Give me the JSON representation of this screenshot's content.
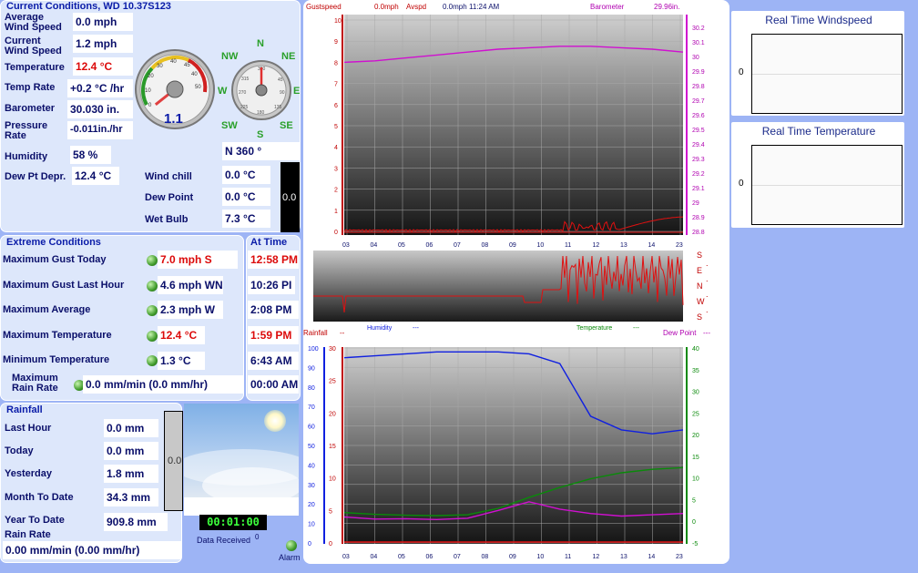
{
  "current": {
    "title": "Current Conditions, WD 10.37S123",
    "avg_wind_label": "Average\nWind Speed",
    "avg_wind": "0.0 mph",
    "cur_wind_label": "Current\nWind Speed",
    "cur_wind": "1.2 mph",
    "temp_label": "Temperature",
    "temp": "12.4 °C",
    "temp_rate_label": "Temp Rate",
    "temp_rate": "+0.2 °C /hr",
    "baro_label": "Barometer",
    "baro": "30.030 in.",
    "press_rate_label": "Pressure\nRate",
    "press_rate": "-0.011in./hr",
    "humidity_label": "Humidity",
    "humidity": "58 %",
    "dewdep_label": "Dew Pt Depr.",
    "dewdep": "12.4 °C",
    "windchill_label": "Wind chill",
    "windchill": "0.0 °C",
    "dewpoint_label": "Dew Point",
    "dewpoint": "0.0 °C",
    "wetbulb_label": "Wet Bulb",
    "wetbulb": "7.3 °C",
    "gauge_value": "1.1",
    "gauge_level": 1.1,
    "wind_dir": "N  360 °",
    "bar_reading": "0.0",
    "compass": {
      "n": "N",
      "ne": "NE",
      "e": "E",
      "se": "SE",
      "s": "S",
      "sw": "SW",
      "w": "W",
      "nw": "NW"
    }
  },
  "extreme": {
    "title": "Extreme Conditions",
    "max_gust_today_label": "Maximum Gust Today",
    "max_gust_today": "7.0 mph S",
    "max_gust_hour_label": "Maximum Gust Last Hour",
    "max_gust_hour": "4.6 mph WN'",
    "max_avg_label": "Maximum Average",
    "max_avg": "2.3 mph W",
    "max_temp_label": "Maximum Temperature",
    "max_temp": "12.4 °C",
    "min_temp_label": "Minimum Temperature",
    "min_temp": "1.3 °C",
    "max_rain_label": "Maximum\nRain Rate",
    "max_rain": "0.0 mm/min (0.0 mm/hr)"
  },
  "attime": {
    "title": "At Time",
    "t1": "12:58 PM",
    "t2": "10:26 PI",
    "t3": "2:08 PM",
    "t4": "1:59 PM",
    "t5": "6:43 AM",
    "t6": "00:00 AM"
  },
  "rainfall": {
    "title": "Rainfall",
    "last_hour_label": "Last Hour",
    "last_hour": "0.0 mm",
    "today_label": "Today",
    "today": "0.0 mm",
    "yesterday_label": "Yesterday",
    "yesterday": "1.8 mm",
    "month_label": "Month To Date",
    "month": "34.3 mm",
    "year_label": "Year To Date",
    "year": "909.8 mm",
    "rate_label": "Rain Rate",
    "rate": "0.00 mm/min (0.00 mm/hr)",
    "gauge_reading": "0.0"
  },
  "status": {
    "timer": "00:01:00",
    "data_received": "Data Received",
    "data_count": "0",
    "alarm": "Alarm"
  },
  "right": {
    "windspeed_title": "Real Time Windspeed",
    "windspeed_value": "0",
    "temp_title": "Real Time Temperature",
    "temp_value": "0"
  },
  "chart_data": [
    {
      "type": "line",
      "header": {
        "gust": "Gustspeed",
        "gust_val": "0.0mph",
        "avg": "Avspd",
        "avg_val": "0.0mph",
        "time": "11:24 AM",
        "baro": "Barometer",
        "baro_val": "29.96in."
      },
      "x_ticks": [
        "03",
        "04",
        "05",
        "06",
        "07",
        "08",
        "09",
        "10",
        "11",
        "12",
        "13",
        "14",
        "23"
      ],
      "y_left": [
        0,
        1,
        2,
        3,
        4,
        5,
        6,
        7,
        8,
        9,
        10
      ],
      "y_right": [
        "30.2",
        "30.1",
        "30",
        "29.9",
        "29.8",
        "29.7",
        "29.6",
        "29.5",
        "29.4",
        "29.3",
        "29.2",
        "29.1",
        "29",
        "28.9",
        "28.8"
      ],
      "series": [
        {
          "name": "Barometer",
          "color": "#d010d0",
          "values": [
            29.96,
            29.97,
            29.99,
            30.01,
            30.03,
            30.05,
            30.06,
            30.07,
            30.07,
            30.06,
            30.05,
            30.03
          ]
        }
      ]
    },
    {
      "type": "line",
      "right_labels": [
        "S",
        "E",
        "N",
        "W",
        "S"
      ],
      "series": [
        {
          "name": "Wind direction",
          "color": "#e01010"
        }
      ]
    },
    {
      "type": "line",
      "header": {
        "rain": "Rainfall",
        "rain_val": "--",
        "hum": "Humidity",
        "hum_val": "---",
        "temp": "Temperature",
        "temp_val": "---",
        "dew": "Dew Point",
        "dew_val": "---"
      },
      "x_ticks": [
        "03",
        "04",
        "05",
        "06",
        "07",
        "08",
        "09",
        "10",
        "11",
        "12",
        "13",
        "14",
        "23"
      ],
      "y_left1": [
        0,
        10,
        20,
        30,
        40,
        50,
        60,
        70,
        80,
        90,
        100
      ],
      "y_left2": [
        0,
        5,
        10,
        15,
        20,
        25,
        30
      ],
      "y_right": [
        -5,
        0,
        5,
        10,
        15,
        20,
        25,
        30,
        35,
        40
      ],
      "series": [
        {
          "name": "Humidity",
          "color": "#1020e0",
          "values": [
            95,
            96,
            97,
            98,
            98,
            98,
            97,
            92,
            65,
            58,
            56,
            58
          ]
        },
        {
          "name": "Temperature",
          "color": "#0a8a0a",
          "values": [
            2.0,
            1.6,
            1.4,
            1.3,
            1.5,
            3.0,
            5.5,
            7.8,
            9.8,
            11.2,
            12.0,
            12.4
          ]
        },
        {
          "name": "Dew Point",
          "color": "#d010d0",
          "values": [
            1.0,
            0.5,
            0.6,
            0.4,
            0.7,
            2.5,
            4.5,
            2.8,
            1.8,
            1.2,
            1.5,
            1.8
          ]
        }
      ]
    }
  ]
}
